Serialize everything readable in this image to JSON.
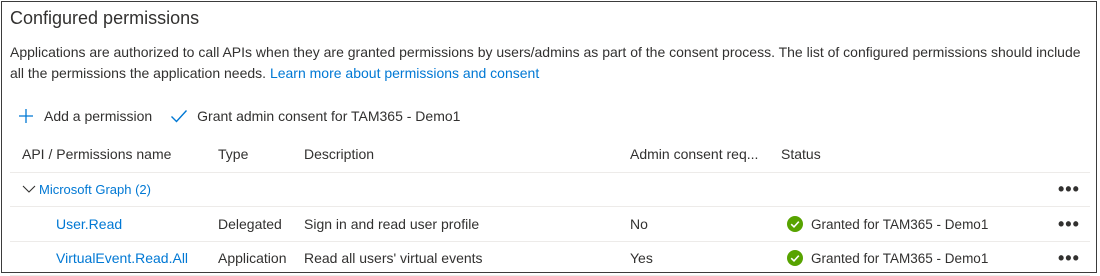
{
  "header": {
    "title": "Configured permissions",
    "description": "Applications are authorized to call APIs when they are granted permissions by users/admins as part of the consent process. The list of configured permissions should include all the permissions the application needs.",
    "learn_more_link": "Learn more about permissions and consent"
  },
  "toolbar": {
    "add_permission": "Add a permission",
    "grant_consent": "Grant admin consent for TAM365 - Demo1"
  },
  "table": {
    "columns": [
      "API / Permissions name",
      "Type",
      "Description",
      "Admin consent req...",
      "Status"
    ],
    "group": {
      "label": "Microsoft Graph (2)"
    },
    "rows": [
      {
        "name": "User.Read",
        "type": "Delegated",
        "description": "Sign in and read user profile",
        "admin_consent": "No",
        "status": "Granted for TAM365 - Demo1"
      },
      {
        "name": "VirtualEvent.Read.All",
        "type": "Application",
        "description": "Read all users' virtual events",
        "admin_consent": "Yes",
        "status": "Granted for TAM365 - Demo1"
      }
    ],
    "more_glyph": "•••"
  },
  "colors": {
    "link": "#0078d4",
    "success": "#57a300",
    "text": "#323130",
    "divider": "#edebe9"
  },
  "icons": {
    "add": "plus-icon",
    "grant": "checkmark-icon",
    "expand": "chevron-down-icon",
    "status": "success-check-circle-icon",
    "more": "more-ellipsis-icon"
  }
}
